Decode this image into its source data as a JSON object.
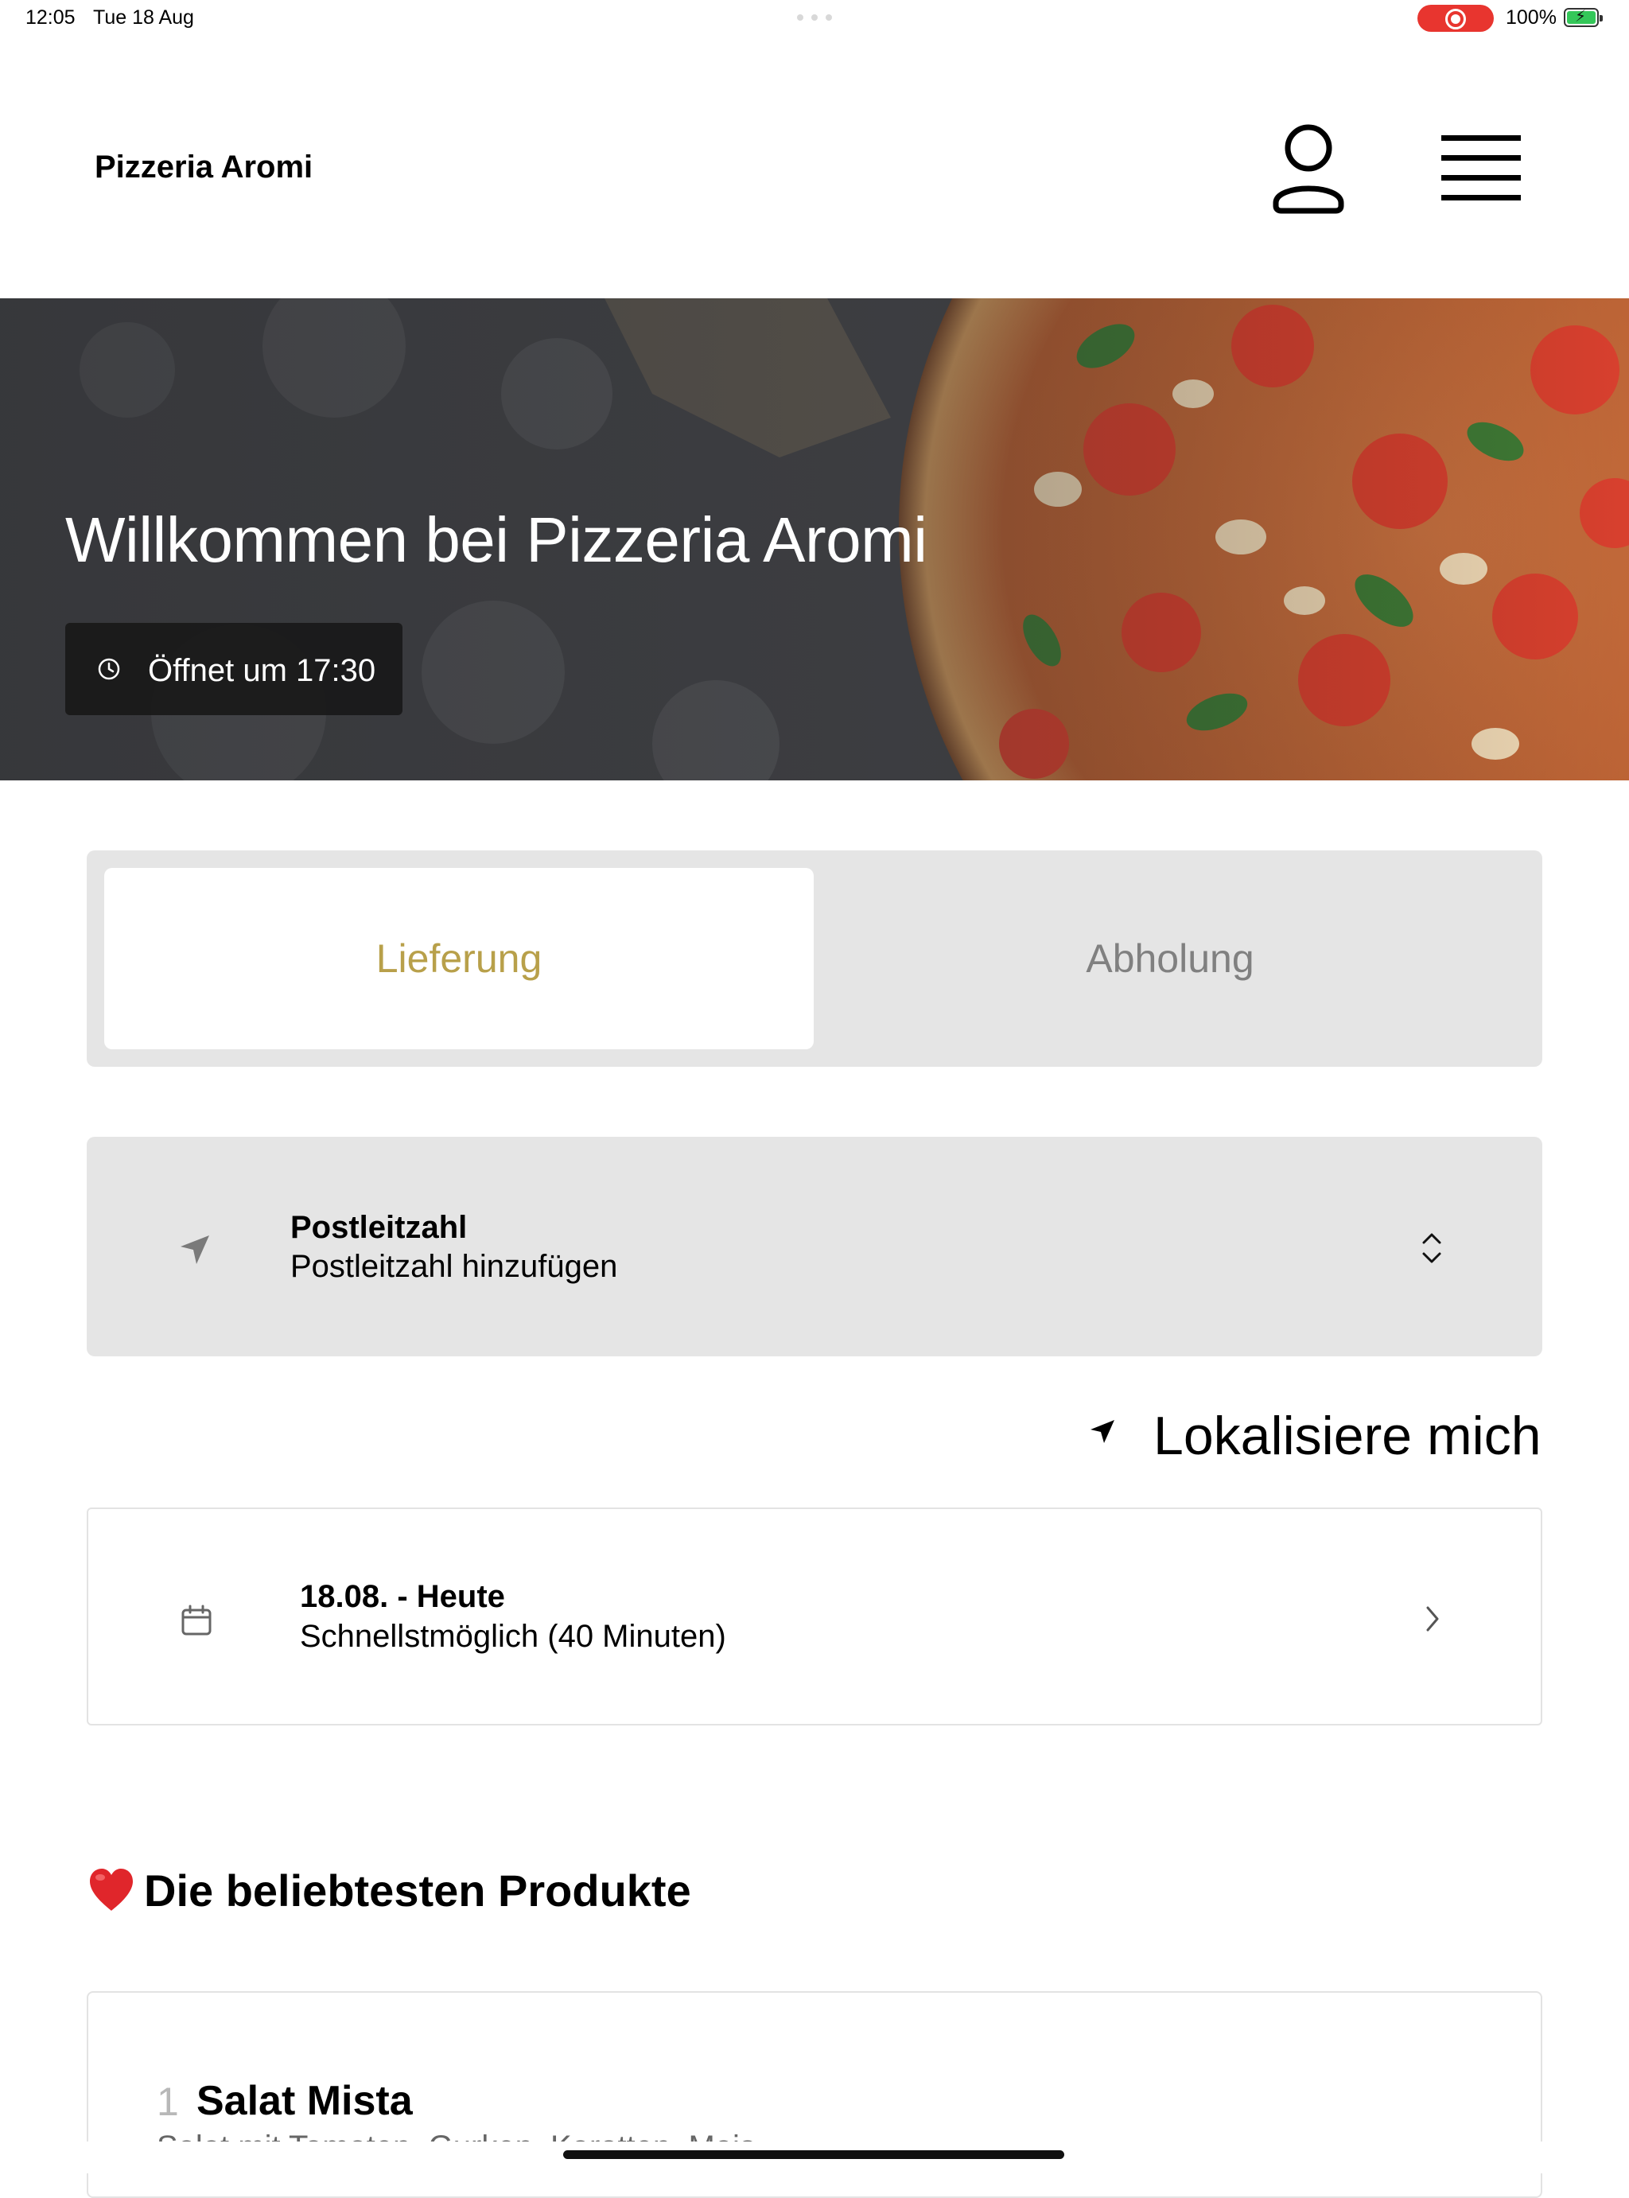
{
  "status_bar": {
    "time": "12:05",
    "date": "Tue 18 Aug",
    "battery": "100%"
  },
  "header": {
    "title": "Pizzeria Aromi",
    "user_icon": "user-icon",
    "menu_icon": "hamburger-menu-icon"
  },
  "hero": {
    "title": "Willkommen bei Pizzeria Aromi",
    "opening_text": "Öffnet um 17:30"
  },
  "order_mode": {
    "options": [
      {
        "label": "Lieferung",
        "active": true
      },
      {
        "label": "Abholung",
        "active": false
      }
    ],
    "active_color": "#b8a04a"
  },
  "postcode": {
    "label": "Postleitzahl",
    "value": "Postleitzahl hinzufügen"
  },
  "localize": {
    "label": "Lokalisiere mich"
  },
  "delivery_time": {
    "title": "18.08. - Heute",
    "subtitle": "Schnellstmöglich (40 Minuten)"
  },
  "popular": {
    "title": "Die beliebtesten Produkte",
    "products": [
      {
        "number": "1",
        "name": "Salat Mista",
        "description": "Salat mit Tomaten, Gurken, Karotten, Mais"
      }
    ]
  }
}
